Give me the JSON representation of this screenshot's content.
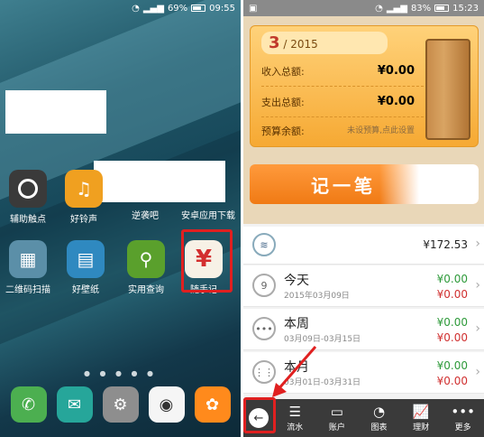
{
  "left": {
    "status": {
      "battery": "69%",
      "time": "09:55"
    },
    "apps_row1": [
      {
        "label": "辅助触点",
        "icon": "assistive-touch-icon",
        "color": "#3a3a3a"
      },
      {
        "label": "好铃声",
        "icon": "music-note-icon",
        "color": "#f0a020"
      },
      {
        "label": "逆袭吧",
        "icon": "",
        "color": ""
      },
      {
        "label": "安卓应用下载",
        "icon": "",
        "color": ""
      }
    ],
    "apps_row2": [
      {
        "label": "二维码扫描",
        "icon": "qr-scan-icon",
        "color": "#5b8fa8"
      },
      {
        "label": "好壁纸",
        "icon": "wallpaper-icon",
        "color": "#2f89c0"
      },
      {
        "label": "实用查询",
        "icon": "search-tools-icon",
        "color": "#5aa02c"
      },
      {
        "label": "随手记",
        "icon": "yen-icon",
        "color": "#f7f1e6"
      }
    ],
    "suishouji_glyph": "¥",
    "dock": [
      {
        "icon": "phone-icon",
        "color": "#4caf50"
      },
      {
        "icon": "messages-icon",
        "color": "#26a69a"
      },
      {
        "icon": "settings-icon",
        "color": "#8e8e8e"
      },
      {
        "icon": "camera-icon",
        "color": "#f5f5f5"
      },
      {
        "icon": "uc-browser-icon",
        "color": "#ff8a1c"
      }
    ]
  },
  "right": {
    "status": {
      "battery": "83%",
      "time": "15:23"
    },
    "card": {
      "month": "3",
      "year": "/ 2015",
      "income_label": "收入总额:",
      "income_value": "¥0.00",
      "expense_label": "支出总额:",
      "expense_value": "¥0.00",
      "budget_label": "预算余额:",
      "budget_value": "未设预算,点此设置"
    },
    "record_button": "记一笔",
    "balance_row": {
      "amount": "¥172.53"
    },
    "list": [
      {
        "title": "今天",
        "date": "2015年03月09日",
        "cal": "9",
        "income": "¥0.00",
        "expense": "¥0.00"
      },
      {
        "title": "本周",
        "date": "03月09日-03月15日",
        "cal": "•••",
        "income": "¥0.00",
        "expense": "¥0.00"
      },
      {
        "title": "本月",
        "date": "03月01日-03月31日",
        "cal": "⋮⋮",
        "income": "¥0.00",
        "expense": "¥0.00"
      }
    ],
    "nav": [
      {
        "label": "流水",
        "glyph": "☰"
      },
      {
        "label": "账户",
        "glyph": "▭"
      },
      {
        "label": "图表",
        "glyph": "◔"
      },
      {
        "label": "理财",
        "glyph": "📈"
      },
      {
        "label": "更多",
        "glyph": "•••"
      }
    ]
  }
}
